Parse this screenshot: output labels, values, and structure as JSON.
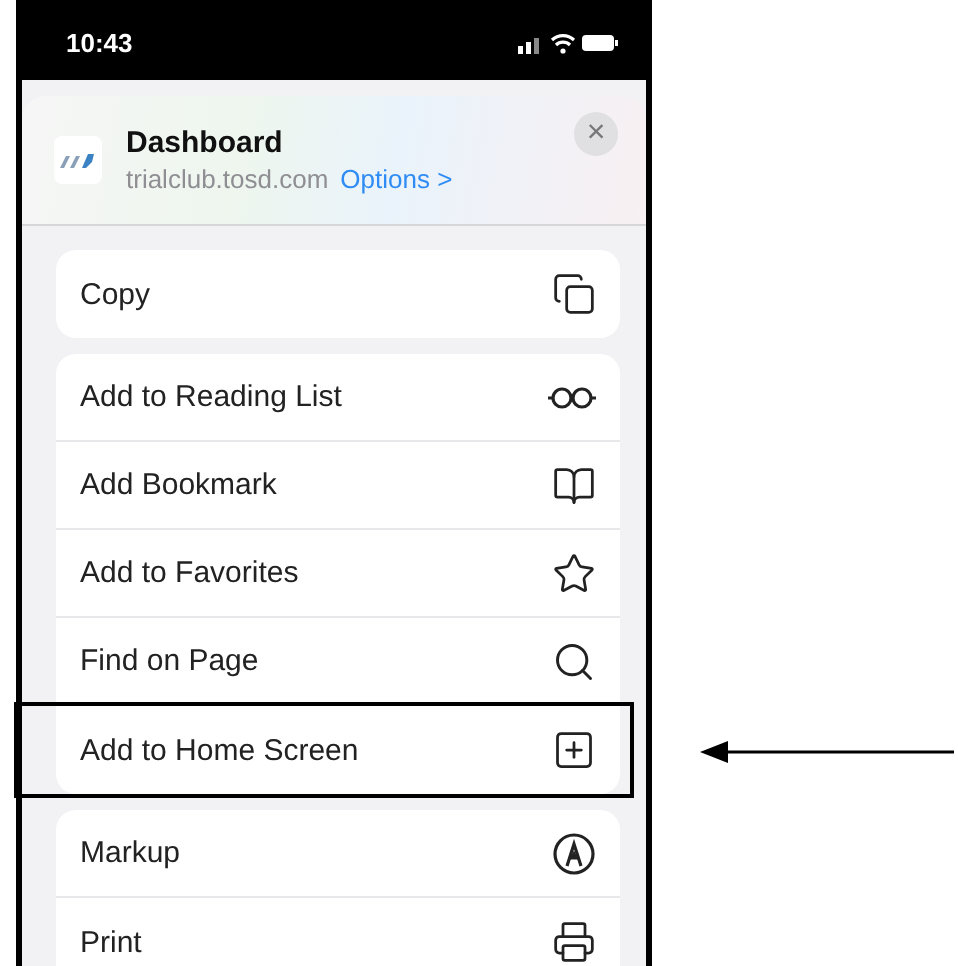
{
  "status_bar": {
    "time": "10:43"
  },
  "header": {
    "title": "Dashboard",
    "url": "trialclub.tosd.com",
    "options_link": "Options >",
    "close": "×"
  },
  "groups": [
    {
      "items": [
        {
          "label": "Copy",
          "highlighted": false
        }
      ]
    },
    {
      "items": [
        {
          "label": "Add to Reading List",
          "highlighted": false
        },
        {
          "label": "Add Bookmark",
          "highlighted": false
        },
        {
          "label": "Add to Favorites",
          "highlighted": false
        },
        {
          "label": "Find on Page",
          "highlighted": false
        },
        {
          "label": "Add to Home Screen",
          "highlighted": true
        }
      ]
    },
    {
      "items": [
        {
          "label": "Markup",
          "highlighted": false
        },
        {
          "label": "Print",
          "highlighted": false
        }
      ]
    }
  ]
}
